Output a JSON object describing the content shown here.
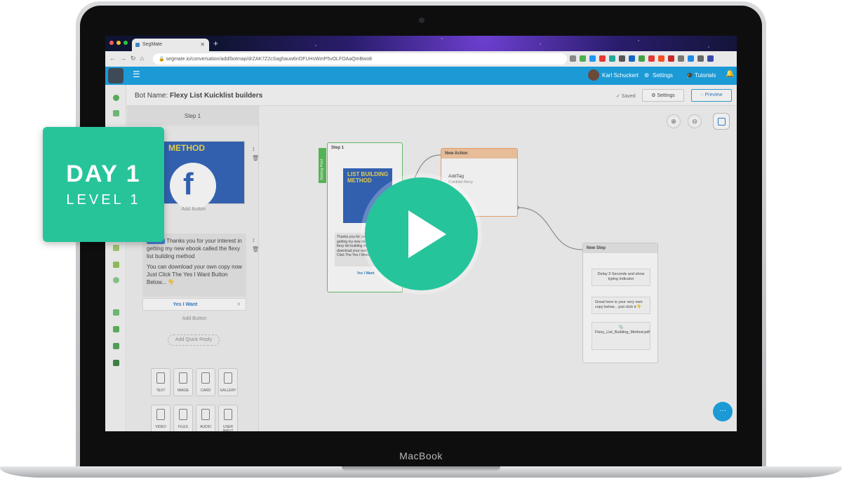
{
  "browser": {
    "tab_title": "SegMate",
    "url": "segmate.io/conversation/add/botmap/drZAK7Z2cSaghauw6nOFUHsWmP5vOLFOAaQmBwo8"
  },
  "header": {
    "user_name": "Karl Schuckert",
    "settings_label": "Settings",
    "tutorials_label": "Tutorials"
  },
  "titlebar": {
    "bot_name_label": "Bot Name:",
    "bot_name": "Flexy List Kuicklist builders",
    "saved_label": "✓ Saved",
    "settings_button": "⚙ Settings",
    "preview_button": "◌ Preview"
  },
  "panel": {
    "title": "Step 1",
    "image_card_title": "METHOD",
    "add_button": "Add Button",
    "message_line1": "Thanks you for your interest in getting my new ebook called the flexy list building method",
    "message_line2": "You can download your own copy now Just Click The Yes I Want Button Below... 👇",
    "yes_button": "Yes I Want",
    "add_button_2": "Add Button",
    "add_quick_reply": "Add Quick Reply",
    "tools": [
      "TEXT",
      "IMAGE",
      "CARD",
      "GALLERY",
      "VIDEO",
      "FILES",
      "AUDIO",
      "USER INPUT"
    ]
  },
  "canvas": {
    "start_label": "Starting Point",
    "step1_title": "Step 1",
    "step1_book": "LIST BUILDING METHOD",
    "step1_text": "Thanks you for your interest in getting my new ebook called the flexy list building method You can download your own copy now. Just Click The Yes I Want Button Below...",
    "step1_yes": "Yes I Want",
    "new_action_title": "New Action",
    "add_tag": "AddTag",
    "add_tag_sub": "Kuicklist Flexy",
    "new_step_title": "New Step",
    "delay_text": "Delay 3 Seconds and show typing indicator",
    "great_text": "Great here is your very own copy below... just click it 👇",
    "file_name": "Flexy_List_Building_Method.pdf"
  },
  "overlay": {
    "badge_day": "DAY 1",
    "badge_level": "LEVEL 1"
  },
  "laptop": {
    "label": "MacBook"
  },
  "colors": {
    "header_blue": "#1c9ad6",
    "badge_green": "#27c49a",
    "play_green": "#26c49b"
  }
}
